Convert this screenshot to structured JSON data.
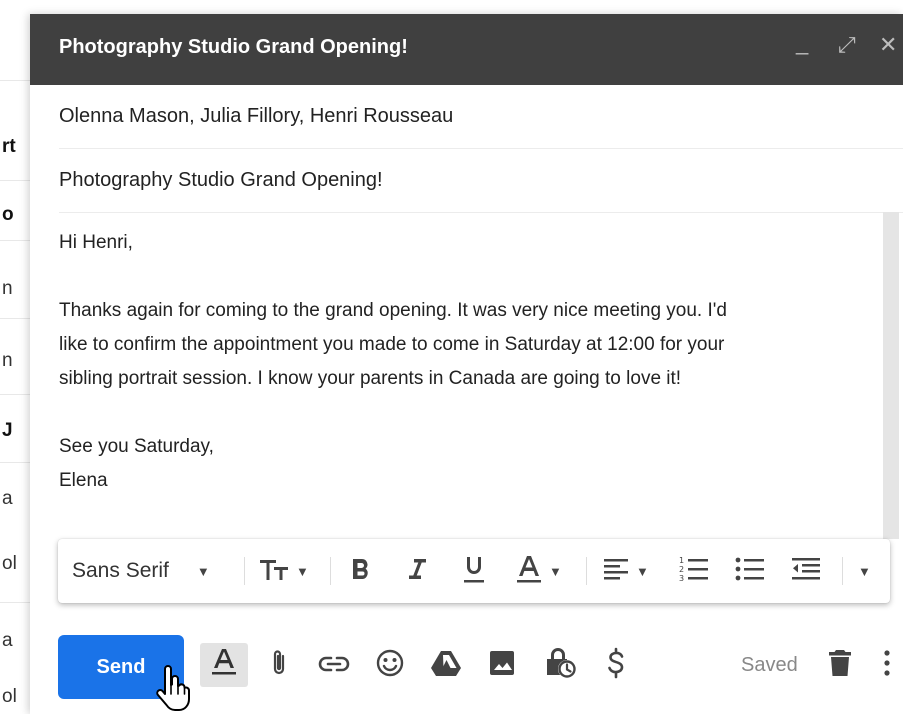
{
  "background": {
    "fragments": [
      {
        "text": "rt",
        "bold": true
      },
      {
        "text": "o",
        "bold": true
      },
      {
        "text": "n",
        "bold": false
      },
      {
        "text": "n",
        "bold": false
      },
      {
        "text": "J",
        "bold": true
      },
      {
        "text": "a",
        "bold": false
      },
      {
        "text": "ol",
        "bold": false
      },
      {
        "text": "a",
        "bold": false
      },
      {
        "text": "ol",
        "bold": false
      }
    ]
  },
  "compose": {
    "title": "Photography Studio Grand Opening!",
    "controls": {
      "minimize": "_",
      "maximize": "⤢",
      "close": "✕"
    },
    "to": "Olenna Mason, Julia Fillory, Henri Rousseau",
    "subject": "Photography Studio Grand Opening!",
    "body": {
      "greeting": "Hi Henri,",
      "line1": "Thanks again for coming to the grand opening. It was very nice meeting you. I'd",
      "line2": "like to confirm the appointment you made to come in Saturday at 12:00 for your",
      "line3": "sibling portrait session. I know your parents in Canada are going to love it!",
      "closing": "See you Saturday,",
      "signature": "Elena"
    }
  },
  "format_toolbar": {
    "font": "Sans Serif",
    "icons": [
      "font-size-icon",
      "bold-icon",
      "italic-icon",
      "underline-icon",
      "text-color-icon",
      "align-icon",
      "numbered-list-icon",
      "bulleted-list-icon",
      "indent-less-icon",
      "more-formatting-icon"
    ]
  },
  "bottom_toolbar": {
    "send_label": "Send",
    "saved_label": "Saved",
    "icons": [
      "formatting-options-icon",
      "attach-icon",
      "link-icon",
      "emoji-icon",
      "drive-icon",
      "photo-icon",
      "confidential-icon",
      "payment-icon",
      "trash-icon",
      "more-options-icon"
    ]
  },
  "colors": {
    "titlebar": "#404040",
    "send_button": "#1a73e8"
  }
}
